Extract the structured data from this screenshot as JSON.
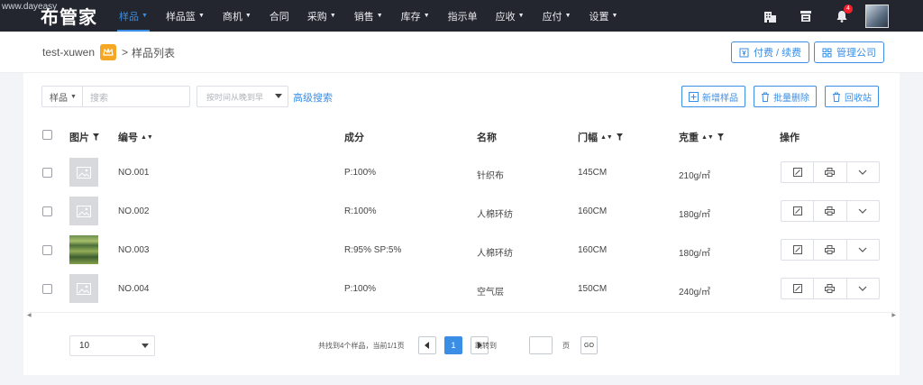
{
  "watermark": "www.dayeasy",
  "app": {
    "brand": "布管家"
  },
  "nav": {
    "items": [
      {
        "label": "样品",
        "caret": true,
        "active": true
      },
      {
        "label": "样品篮",
        "caret": true
      },
      {
        "label": "商机",
        "caret": true
      },
      {
        "label": "合同",
        "caret": false
      },
      {
        "label": "采购",
        "caret": true
      },
      {
        "label": "销售",
        "caret": true
      },
      {
        "label": "库存",
        "caret": true
      },
      {
        "label": "指示单",
        "caret": false
      },
      {
        "label": "应收",
        "caret": true
      },
      {
        "label": "应付",
        "caret": true
      },
      {
        "label": "设置",
        "caret": true
      }
    ],
    "notification_count": "4",
    "icons": [
      "building-icon",
      "store-icon",
      "bell-icon"
    ]
  },
  "breadcrumb": {
    "company": "test-xuwen",
    "separator": ">",
    "current": "样品列表"
  },
  "header_buttons": {
    "pay_renew": "付费 / 续费",
    "manage_company": "管理公司"
  },
  "toolbar": {
    "filter_select": "样品",
    "search_placeholder": "搜索",
    "sort_placeholder": "按时间从晚到早",
    "advanced_search": "高级搜索",
    "add_sample": "新增样品",
    "batch_delete": "批量删除",
    "recycle_bin": "回收站"
  },
  "table": {
    "columns": {
      "image": "图片",
      "code": "编号",
      "composition": "成分",
      "name": "名称",
      "width": "门幅",
      "weight": "克重",
      "actions": "操作"
    },
    "rows": [
      {
        "code": "NO.001",
        "composition": "P:100%",
        "name": "针织布",
        "width": "145CM",
        "weight": "210g/㎡",
        "photo": false
      },
      {
        "code": "NO.002",
        "composition": "R:100%",
        "name": "人棉环纺",
        "width": "160CM",
        "weight": "180g/㎡",
        "photo": false
      },
      {
        "code": "NO.003",
        "composition": "R:95% SP:5%",
        "name": "人棉环纺",
        "width": "160CM",
        "weight": "180g/㎡",
        "photo": true
      },
      {
        "code": "NO.004",
        "composition": "P:100%",
        "name": "空气层",
        "width": "150CM",
        "weight": "240g/㎡",
        "photo": false
      }
    ]
  },
  "pagination": {
    "page_size": "10",
    "summary": "共找到4个样品，当前1/1页",
    "current_page": "1",
    "jump_label": "跳转到",
    "page_unit": "页",
    "go": "GO"
  },
  "colors": {
    "accent": "#3a8ee6",
    "navbar": "#23262e",
    "crown": "#f5a623"
  }
}
